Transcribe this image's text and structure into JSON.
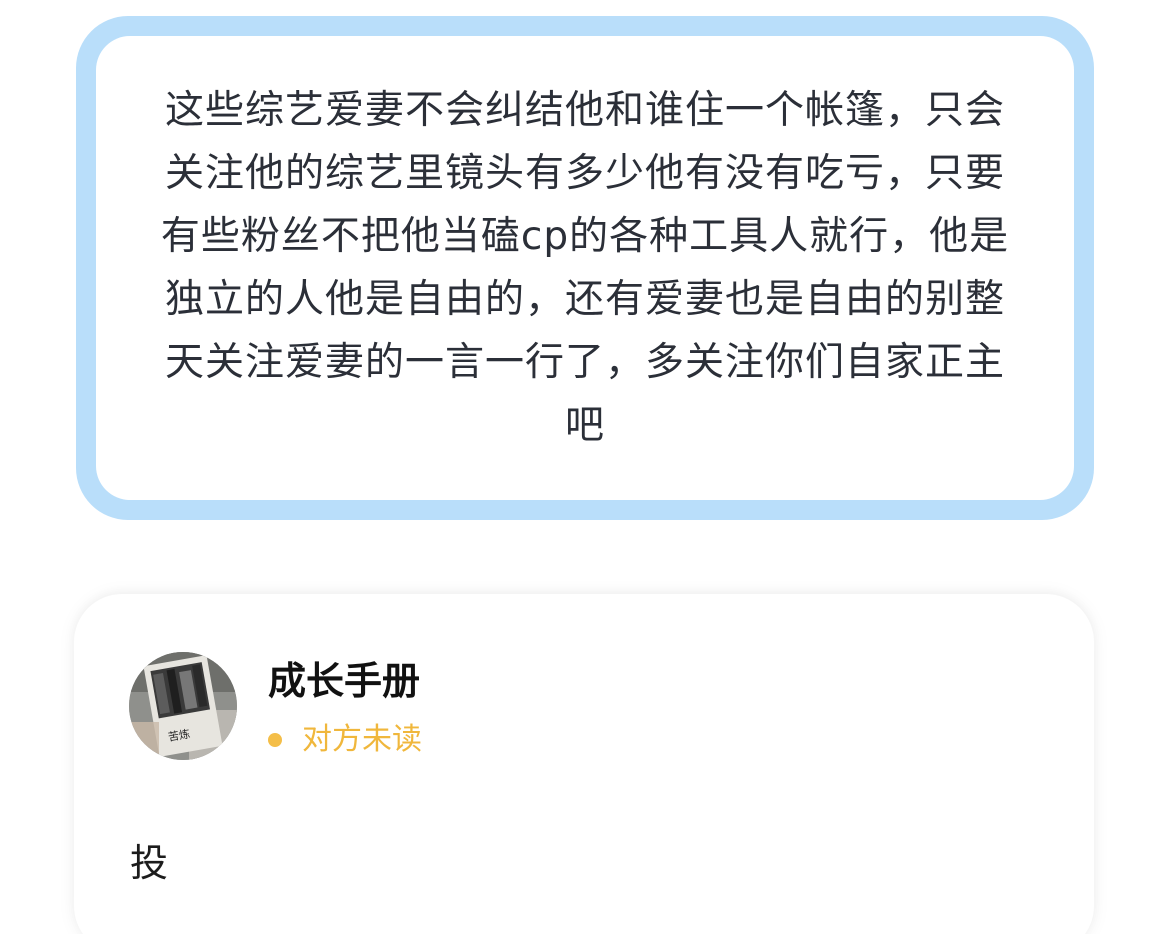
{
  "quote": {
    "text": "这些综艺爱妻不会纠结他和谁住一个帐篷，只会关注他的综艺里镜头有多少他有没有吃亏，只要有些粉丝不把他当磕cp的各种工具人就行，他是独立的人他是自由的，还有爱妻也是自由的别整天关注爱妻的一言一行了，多关注你们自家正主吧",
    "border_color": "#b9defa"
  },
  "reply": {
    "user_name": "成长手册",
    "status_text": "对方未读",
    "status_color": "#f0b73c",
    "avatar_book_title": "苦炼",
    "avatar_icon": "avatar-book-photo",
    "message": "投"
  }
}
